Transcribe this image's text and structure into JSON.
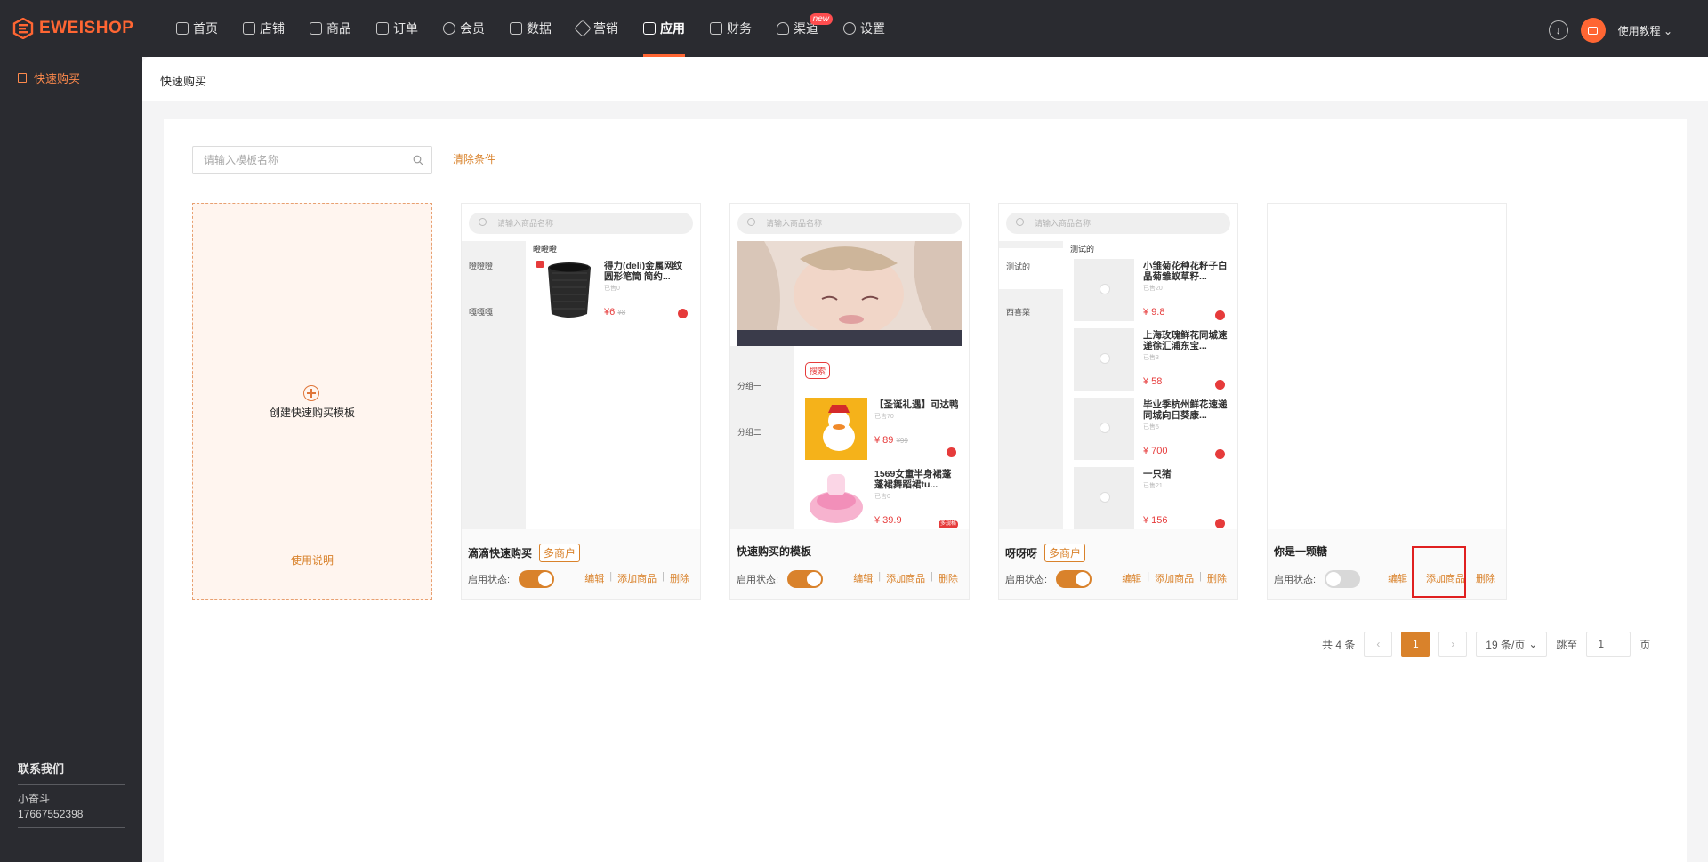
{
  "brand": {
    "name": "EWEISHOP"
  },
  "nav": {
    "items": [
      {
        "label": "首页",
        "icon": "home-icon"
      },
      {
        "label": "店铺",
        "icon": "store-icon"
      },
      {
        "label": "商品",
        "icon": "goods-icon"
      },
      {
        "label": "订单",
        "icon": "order-icon"
      },
      {
        "label": "会员",
        "icon": "member-icon"
      },
      {
        "label": "数据",
        "icon": "chart-icon"
      },
      {
        "label": "营销",
        "icon": "tag-icon"
      },
      {
        "label": "应用",
        "icon": "app-icon",
        "active": true
      },
      {
        "label": "财务",
        "icon": "finance-icon"
      },
      {
        "label": "渠道",
        "icon": "channel-icon",
        "badge": "new"
      },
      {
        "label": "设置",
        "icon": "gear-icon"
      }
    ],
    "tutorial": "使用教程"
  },
  "sidebar": {
    "item": "快速购买",
    "contact_title": "联系我们",
    "contact_name": "小奋斗",
    "contact_phone": "17667552398"
  },
  "breadcrumb": "快速购买",
  "filter": {
    "placeholder": "请输入模板名称",
    "clear": "清除条件"
  },
  "create_card": {
    "label": "创建快速购买模板",
    "help": "使用说明"
  },
  "preview": {
    "search_placeholder": "请输入商品名称"
  },
  "templates": [
    {
      "name": "滴滴快速购买",
      "tag": "多商户",
      "enabled": true,
      "groups": [
        "瞪瞪瞪",
        "嘎嘎嘎"
      ],
      "section": "瞪瞪瞪",
      "products": [
        {
          "title": "得力(deli)金属网纹圆形笔筒 简约...",
          "sold": "已售0",
          "price": "¥6",
          "orig": "¥8"
        }
      ]
    },
    {
      "name": "快速购买的模板",
      "tag": "",
      "enabled": true,
      "groups": [
        "分组一",
        "分组二"
      ],
      "search_btn": "搜索",
      "products": [
        {
          "title": "【圣诞礼遇】可达鸭",
          "sold": "已售70",
          "price": "¥ 89",
          "orig": "¥99"
        },
        {
          "title": "1569女童半身裙蓬蓬裙舞蹈裙tu...",
          "sold": "已售0",
          "price": "¥ 39.9",
          "badge": "多规格"
        }
      ]
    },
    {
      "name": "呀呀呀",
      "tag": "多商户",
      "enabled": true,
      "groups": [
        "测试的",
        "西喜菜"
      ],
      "section": "测试的",
      "products": [
        {
          "title": "小雏菊花种花籽子白晶菊雏蚁草籽...",
          "sold": "已售20",
          "price": "¥ 9.8"
        },
        {
          "title": "上海玫瑰鲜花同城速递徐汇浦东宝...",
          "sold": "已售3",
          "price": "¥ 58"
        },
        {
          "title": "毕业季杭州鲜花速递同城向日葵康...",
          "sold": "已售5",
          "price": "¥ 700"
        },
        {
          "title": "一只猪",
          "sold": "已售21",
          "price": "¥ 156"
        }
      ]
    },
    {
      "name": "你是一颗糖",
      "tag": "",
      "enabled": false,
      "groups": [],
      "products": []
    }
  ],
  "labels": {
    "status": "启用状态:",
    "edit": "编辑",
    "add_goods": "添加商品",
    "delete": "删除"
  },
  "pagination": {
    "total": "共 4 条",
    "current": "1",
    "page_size": "19 条/页",
    "jump_label": "跳至",
    "jump_value": "1",
    "page_unit": "页"
  },
  "colors": {
    "accent": "#d9822b",
    "brand": "#ff6633",
    "dark": "#2a2b30",
    "price": "#e63b3b"
  }
}
